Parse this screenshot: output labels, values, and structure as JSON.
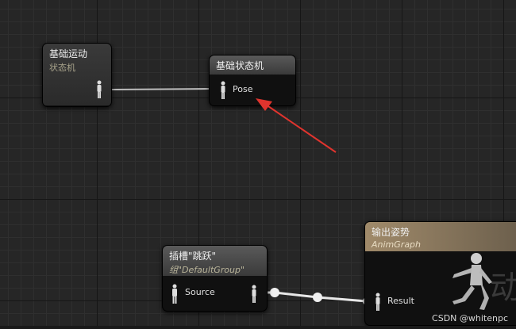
{
  "nodes": {
    "base_locomotion": {
      "title": "基础运动",
      "subtitle": "状态机"
    },
    "base_state_machine": {
      "title": "基础状态机",
      "pin_label": "Pose"
    },
    "slot_jump": {
      "title": "插槽\"跳跃\"",
      "subtitle": "组\"DefaultGroup\"",
      "pin_label": "Source"
    },
    "output_pose": {
      "title": "输出姿势",
      "subtitle": "AnimGraph",
      "pin_label": "Result",
      "watermark_glyph": "动"
    }
  },
  "watermark": "CSDN @whitenpc",
  "colors": {
    "annotation_arrow": "#e0342e",
    "node_header_output": "#a08a6a",
    "grid_bg": "#262626"
  },
  "icons": [
    "person-pin-icon",
    "mannequin-icon",
    "annotation-arrow"
  ]
}
